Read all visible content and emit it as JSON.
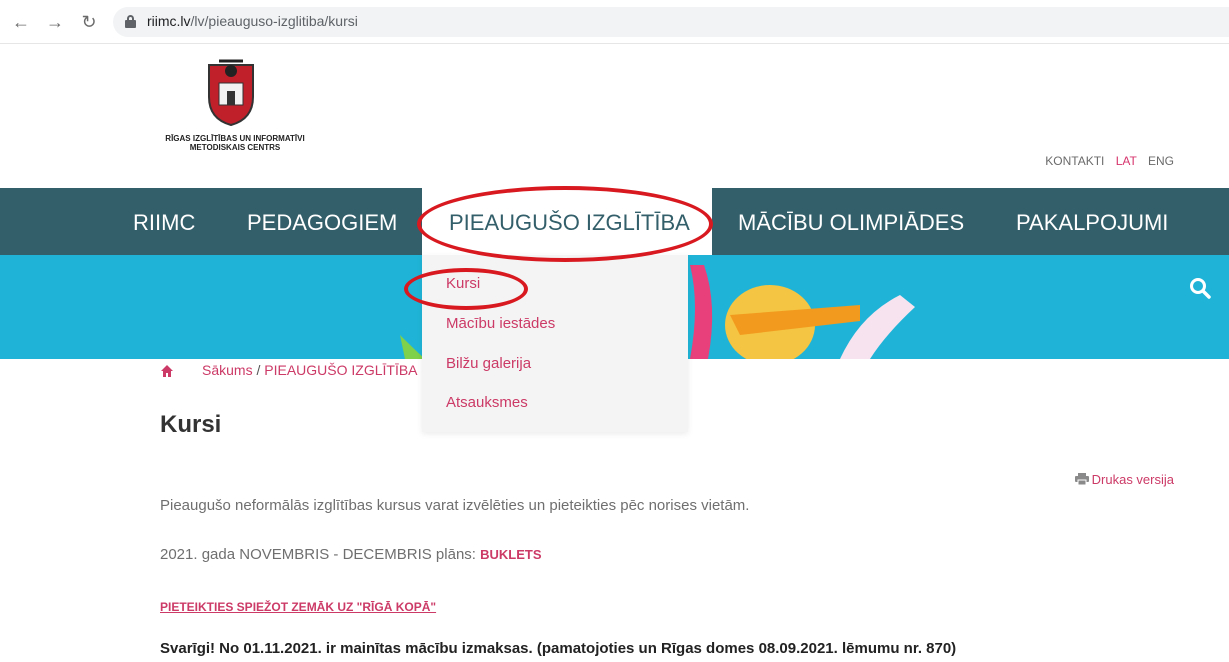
{
  "browser": {
    "url_domain": "riimc.lv",
    "url_path": "/lv/pieauguso-izglitiba/kursi"
  },
  "header": {
    "logo_text": "RĪGAS IZGLĪTĪBAS UN INFORMATĪVI METODISKAIS CENTRS",
    "top_links": [
      "KONTAKTI",
      "LAT",
      "ENG"
    ]
  },
  "nav": {
    "items": [
      "RIIMC",
      "PEDAGOGIEM",
      "PIEAUGUŠO IZGLĪTĪBA",
      "MĀCĪBU OLIMPIĀDES",
      "PAKALPOJUMI"
    ]
  },
  "dropdown": {
    "items": [
      "Kursi",
      "Mācību iestādes",
      "Bilžu galerija",
      "Atsauksmes"
    ]
  },
  "breadcrumb": {
    "home": "Sākums",
    "sep": " / ",
    "section": "PIEAUGUŠO IZGLĪTĪBA"
  },
  "content": {
    "title": "Kursi",
    "print_label": "Drukas versija",
    "intro": "Pieaugušo neformālās izglītības kursus varat izvēlēties un pieteikties pēc norises vietām.",
    "plan_text": "2021. gada NOVEMBRIS - DECEMBRIS plāns: ",
    "plan_link": "BUKLETS",
    "apply_link": "PIETEIKTIES SPIEŽOT ZEMĀK UZ \"RĪGĀ KOPĀ\"",
    "important": "Svarīgi! No 01.11.2021. ir mainītas mācību izmaksas. (pamatojoties un Rīgas domes 08.09.2021. lēmumu nr. 870)"
  },
  "colors": {
    "nav_bg": "#335f6a",
    "banner": "#1fb4d7",
    "accent": "#cc3a67",
    "annotation": "#d8191f"
  }
}
